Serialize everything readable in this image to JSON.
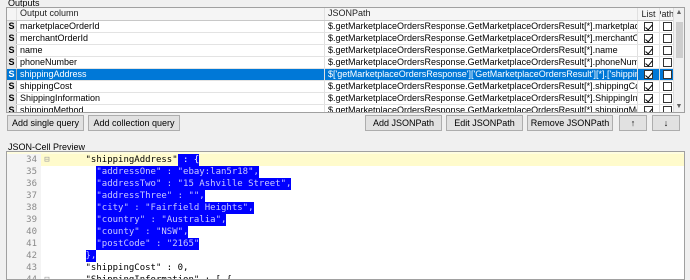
{
  "outputs": {
    "group_label": "Outputs",
    "headers": {
      "s": "",
      "output_column": "Output column",
      "json_path": "JSONPath",
      "list": "List",
      "paths": "Paths"
    },
    "rows": [
      {
        "s": "S",
        "name": "marketplaceOrderId",
        "path": "$.getMarketplaceOrdersResponse.GetMarketplaceOrdersResult[*].marketplaceOrderId",
        "list": true,
        "paths": false,
        "selected": false
      },
      {
        "s": "S",
        "name": "merchantOrderId",
        "path": "$.getMarketplaceOrdersResponse.GetMarketplaceOrdersResult[*].merchantOrderId",
        "list": true,
        "paths": false,
        "selected": false
      },
      {
        "s": "S",
        "name": "name",
        "path": "$.getMarketplaceOrdersResponse.GetMarketplaceOrdersResult[*].name",
        "list": true,
        "paths": false,
        "selected": false
      },
      {
        "s": "S",
        "name": "phoneNumber",
        "path": "$.getMarketplaceOrdersResponse.GetMarketplaceOrdersResult[*].phoneNumber",
        "list": true,
        "paths": false,
        "selected": false
      },
      {
        "s": "S",
        "name": "shippingAddress",
        "path": "$['getMarketplaceOrdersResponse']['GetMarketplaceOrdersResult'][*].['shippingAddress']",
        "list": true,
        "paths": false,
        "selected": true
      },
      {
        "s": "S",
        "name": "shippingCost",
        "path": "$.getMarketplaceOrdersResponse.GetMarketplaceOrdersResult[*].shippingCost",
        "list": true,
        "paths": false,
        "selected": false
      },
      {
        "s": "S",
        "name": "ShippingInformation",
        "path": "$.getMarketplaceOrdersResponse.GetMarketplaceOrdersResult[*].ShippingInformation",
        "list": true,
        "paths": false,
        "selected": false
      },
      {
        "s": "S",
        "name": "shippingMethod",
        "path": "$.getMarketplaceOrdersResponse.GetMarketplaceOrdersResult[*].shippingMethod",
        "list": true,
        "paths": false,
        "selected": false
      }
    ]
  },
  "toolbar": {
    "add_single_query": "Add single query",
    "add_collection_query": "Add collection query",
    "add_jsonpath": "Add JSONPath",
    "edit_jsonpath": "Edit JSONPath",
    "remove_jsonpath": "Remove JSONPath",
    "move_up": "↑",
    "move_down": "↓"
  },
  "preview": {
    "label": "JSON-Cell Preview",
    "lines": [
      {
        "num": "34",
        "fold": "⊟",
        "indent": "      ",
        "text": "\"shippingAddress\"",
        "sel_suffix": " : {",
        "selected": "partial-first"
      },
      {
        "num": "35",
        "fold": "",
        "indent": "        ",
        "text": "\"addressOne\" : \"ebay:lan5r18\",",
        "selected": "full"
      },
      {
        "num": "36",
        "fold": "",
        "indent": "        ",
        "text": "\"addressTwo\" : \"15 Ashville Street\",",
        "selected": "full"
      },
      {
        "num": "37",
        "fold": "",
        "indent": "        ",
        "text": "\"addressThree\" : \"\",",
        "selected": "full"
      },
      {
        "num": "38",
        "fold": "",
        "indent": "        ",
        "text": "\"city\" : \"Fairfield Heights\",",
        "selected": "full"
      },
      {
        "num": "39",
        "fold": "",
        "indent": "        ",
        "text": "\"country\" : \"Australia\",",
        "selected": "full"
      },
      {
        "num": "40",
        "fold": "",
        "indent": "        ",
        "text": "\"county\" : \"NSW\",",
        "selected": "full"
      },
      {
        "num": "41",
        "fold": "",
        "indent": "        ",
        "text": "\"postCode\" : \"2165\"",
        "selected": "full"
      },
      {
        "num": "42",
        "fold": "",
        "indent": "      ",
        "text": "},",
        "selected": "brace"
      },
      {
        "num": "43",
        "fold": "",
        "indent": "      ",
        "text": "\"shippingCost\" : 0,",
        "selected": "none"
      },
      {
        "num": "44",
        "fold": "⊟",
        "indent": "      ",
        "text": "\"ShippingInformation\" : [ {",
        "selected": "none"
      }
    ]
  }
}
